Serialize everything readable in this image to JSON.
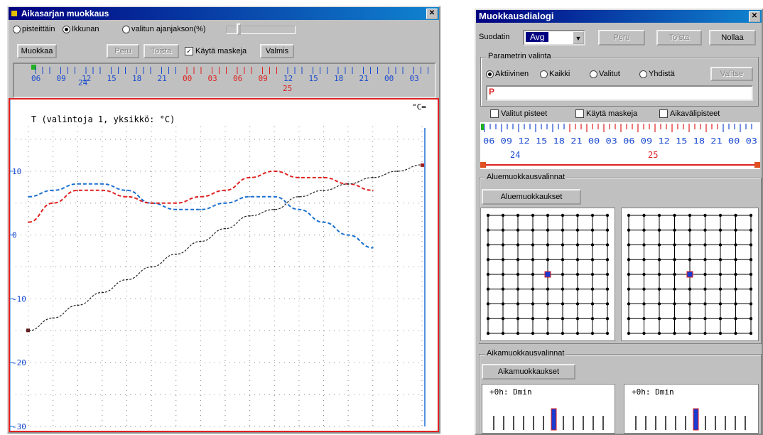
{
  "left_window": {
    "title": "Aikasarjan muokkaus",
    "radio_options": [
      "pisteittäin",
      "Ikkunan",
      "valitun ajanjakson(%)"
    ],
    "radio_selected": 1,
    "buttons": {
      "muokkaa": "Muokkaa",
      "peru": "Peru",
      "toista": "Toista",
      "valmis": "Valmis"
    },
    "checkbox_label": "Käytä maskeja",
    "checkbox_checked": true,
    "hour_ticks": [
      "06",
      "09",
      "12",
      "15",
      "18",
      "21",
      "00",
      "03",
      "06",
      "09",
      "12",
      "15",
      "18",
      "21",
      "00",
      "03"
    ],
    "day_labels": [
      "24",
      "25"
    ],
    "chart_caption": "T (valintoja 1, yksikkö: °C)",
    "unit_corner": "°C=",
    "y_ticks": [
      "10",
      "0",
      "-10",
      "-20",
      "-30"
    ]
  },
  "right_window": {
    "title": "Muokkausdialogi",
    "filter_label": "Suodatin",
    "filter_value": "Avg",
    "buttons": {
      "peru": "Peru",
      "toista": "Toista",
      "nollaa": "Nollaa",
      "valitse": "Valitse",
      "aluemuokkaukset": "Aluemuokkaukset",
      "aikamuokkaukset": "Aikamuokkaukset"
    },
    "param_group_title": "Parametrin valinta",
    "param_radios": [
      "Aktiivinen",
      "Kaikki",
      "Valitut",
      "Yhdistä"
    ],
    "param_selected": 0,
    "param_field_value": "P",
    "checkboxes": [
      "Valitut pisteet",
      "Käytä maskeja",
      "Aikavälipisteet"
    ],
    "time_ticks": "06 09 12 15 18 21 00 03 06 09 12 15 18 21 00 03",
    "day_labels": [
      "24",
      "25"
    ],
    "area_group_title": "Aluemuokkausvalinnat",
    "time_group_title": "Aikamuokkausvalinnat",
    "mini_labels": [
      "+0h: Dmin",
      "+0h: Dmin"
    ]
  },
  "chart_data": {
    "type": "line",
    "title": "T (valintoja 1, yksikkö: °C)",
    "ylim": [
      -30,
      17
    ],
    "x": [
      0,
      1,
      2,
      3,
      4,
      5,
      6,
      7,
      8,
      9,
      10,
      11,
      12,
      13,
      14,
      15,
      16
    ],
    "series": [
      {
        "color": "#1a6fd0",
        "values": [
          6,
          7,
          8,
          8,
          7,
          5,
          4,
          4,
          5,
          6,
          6,
          4,
          2,
          0,
          -2,
          null,
          null
        ]
      },
      {
        "color": "#e02020",
        "values": [
          2,
          5,
          7,
          7,
          6,
          5,
          5,
          6,
          7,
          9,
          10,
          9,
          9,
          8,
          7,
          null,
          null
        ]
      },
      {
        "color": "#202020",
        "values": [
          -15,
          -13,
          -11,
          -9,
          -7,
          -5,
          -3,
          -1,
          1,
          3,
          4,
          6,
          7,
          8,
          9,
          10,
          11
        ]
      }
    ]
  }
}
